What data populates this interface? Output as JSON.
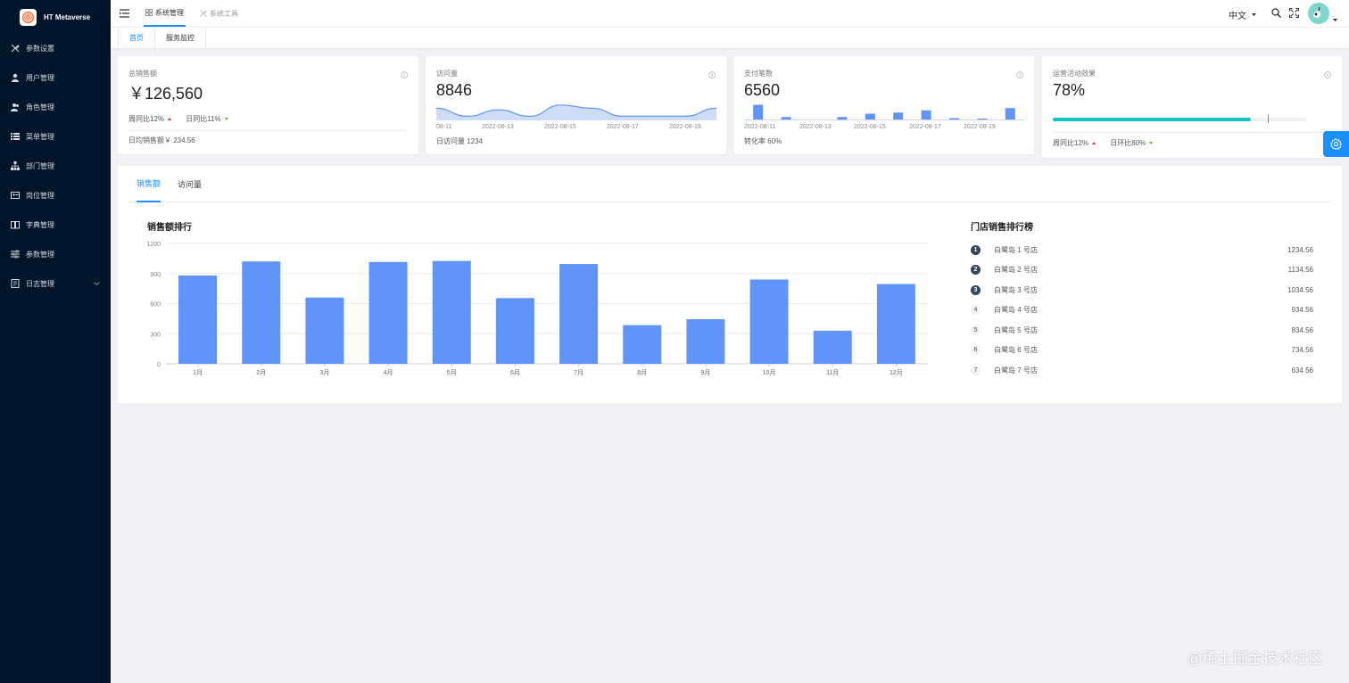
{
  "app": {
    "title": "HT Metaverse"
  },
  "sidebar": {
    "items": [
      {
        "label": "参数设置",
        "icon": "tools-icon"
      },
      {
        "label": "用户管理",
        "icon": "user-icon"
      },
      {
        "label": "角色管理",
        "icon": "users-icon"
      },
      {
        "label": "菜单管理",
        "icon": "list-icon"
      },
      {
        "label": "部门管理",
        "icon": "org-icon"
      },
      {
        "label": "岗位管理",
        "icon": "id-card-icon"
      },
      {
        "label": "字典管理",
        "icon": "book-icon"
      },
      {
        "label": "参数管理",
        "icon": "sliders-icon"
      },
      {
        "label": "日志管理",
        "icon": "log-icon"
      }
    ]
  },
  "header": {
    "tabs": [
      {
        "label": "系统管理",
        "icon": "grid-icon",
        "active": true
      },
      {
        "label": "系统工具",
        "icon": "tools-icon",
        "active": false
      }
    ],
    "language": "中文"
  },
  "tags": [
    {
      "label": "首页",
      "active": true
    },
    {
      "label": "服务监控",
      "active": false
    }
  ],
  "cards": {
    "sales": {
      "title": "总销售额",
      "value": "￥126,560",
      "week_label": "周同比12%",
      "day_label": "日同比11%",
      "footer": "日均销售额￥ 234.56"
    },
    "visits": {
      "title": "访问量",
      "value": "8846",
      "footer": "日访问量 1234"
    },
    "payments": {
      "title": "支付笔数",
      "value": "6560",
      "footer": "转化率 60%"
    },
    "operations": {
      "title": "运营活动效果",
      "value": "78%",
      "progress": 0.78,
      "target": 0.85,
      "week_label": "周同比12%",
      "day_label": "日环比80%",
      "progress_color": "#13c2c2"
    }
  },
  "mini_axis": {
    "visits": [
      "08-11",
      "2022-08-13",
      "2022-08-15",
      "2022-08-17",
      "2022-08-19"
    ],
    "payments": [
      "2022-08-11",
      "2022-08-13",
      "2022-08-15",
      "2022-08-17",
      "2022-08-19"
    ]
  },
  "panel": {
    "tabs": [
      {
        "label": "销售额",
        "active": true
      },
      {
        "label": "访问量",
        "active": false
      }
    ],
    "chart_title": "销售额排行",
    "rank_title": "门店销售排行榜",
    "rankings": [
      {
        "no": "1",
        "name": "白鹭岛 1 号店",
        "value": "1234.56"
      },
      {
        "no": "2",
        "name": "白鹭岛 2 号店",
        "value": "1134.56"
      },
      {
        "no": "3",
        "name": "白鹭岛 3 号店",
        "value": "1034.56"
      },
      {
        "no": "4",
        "name": "白鹭岛 4 号店",
        "value": "934.56"
      },
      {
        "no": "5",
        "name": "白鹭岛 5 号店",
        "value": "834.56"
      },
      {
        "no": "6",
        "name": "白鹭岛 6 号店",
        "value": "734.56"
      },
      {
        "no": "7",
        "name": "白鹭岛 7 号店",
        "value": "634.56"
      }
    ]
  },
  "watermark": "@稀土掘金技术社区",
  "colors": {
    "accent": "#1890ff",
    "bar": "#6094f8",
    "sidebar_bg": "#001529",
    "area_fill": "#cfdcf8",
    "area_stroke": "#6094f8"
  },
  "chart_data": [
    {
      "type": "bar",
      "title": "销售额排行",
      "categories": [
        "1月",
        "2月",
        "3月",
        "4月",
        "5月",
        "6月",
        "7月",
        "8月",
        "9月",
        "10月",
        "11月",
        "12月"
      ],
      "values": [
        880,
        1020,
        660,
        1015,
        1025,
        655,
        995,
        385,
        445,
        840,
        330,
        795
      ],
      "yticks": [
        0,
        300,
        600,
        900,
        1200
      ],
      "ylim": [
        0,
        1200
      ],
      "xlabel": "",
      "ylabel": ""
    },
    {
      "type": "area",
      "x": [
        "2022-08-11",
        "2022-08-12",
        "2022-08-13",
        "2022-08-14",
        "2022-08-15",
        "2022-08-16",
        "2022-08-17",
        "2022-08-18",
        "2022-08-19",
        "2022-08-20"
      ],
      "values": [
        7,
        2,
        6,
        2,
        9,
        7,
        2,
        2,
        2,
        7
      ],
      "ylim": [
        0,
        10
      ]
    },
    {
      "type": "bar",
      "x": [
        "2022-08-11",
        "2022-08-12",
        "2022-08-13",
        "2022-08-14",
        "2022-08-15",
        "2022-08-16",
        "2022-08-17",
        "2022-08-18",
        "2022-08-19",
        "2022-08-20"
      ],
      "values": [
        7,
        1.5,
        0,
        1.5,
        3,
        3.5,
        4.5,
        1,
        0.8,
        5.5
      ],
      "ylim": [
        0,
        8
      ]
    }
  ]
}
